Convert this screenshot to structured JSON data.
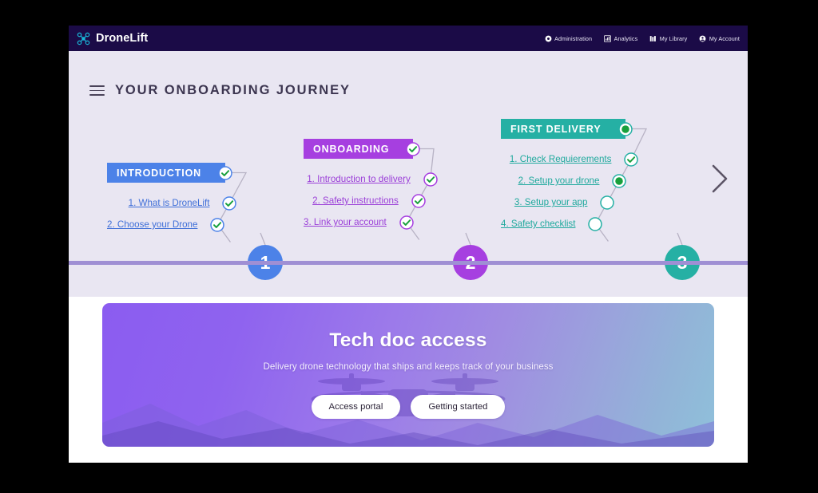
{
  "header": {
    "brand": "DroneLift",
    "logo_icon": "drone-icon",
    "nav": [
      {
        "label": "Administration",
        "icon": "gear-icon"
      },
      {
        "label": "Analytics",
        "icon": "bar-chart-icon"
      },
      {
        "label": "My Library",
        "icon": "books-icon"
      },
      {
        "label": "My Account",
        "icon": "user-circle-icon"
      }
    ]
  },
  "journey": {
    "menu_icon": "hamburger-menu-icon",
    "title": "YOUR ONBOARDING JOURNEY",
    "next_icon": "chevron-right-icon",
    "rail_color": "#9f8fd4",
    "steps": [
      {
        "number": "1",
        "label": "INTRODUCTION",
        "color": "#4c82e8",
        "link_color": "#3f6fd8",
        "badge_state": "complete",
        "items": [
          {
            "label": "1. What is DroneLift",
            "state": "complete"
          },
          {
            "label": "2. Choose your Drone",
            "state": "complete"
          }
        ]
      },
      {
        "number": "2",
        "label": "ONBOARDING",
        "color": "#a63fe0",
        "link_color": "#9b3fd8",
        "badge_state": "complete",
        "items": [
          {
            "label": "1. Introduction to delivery",
            "state": "complete"
          },
          {
            "label": "2. Safety instructions",
            "state": "complete"
          },
          {
            "label": "3. Link your account",
            "state": "complete"
          }
        ]
      },
      {
        "number": "3",
        "label": "FIRST DELIVERY",
        "color": "#25b0a4",
        "link_color": "#1fa99d",
        "badge_state": "current",
        "items": [
          {
            "label": "1. Check Requierements",
            "state": "complete"
          },
          {
            "label": "2. Setup your drone",
            "state": "current"
          },
          {
            "label": "3. Setup your app",
            "state": "pending"
          },
          {
            "label": "4. Safety checklist",
            "state": "pending"
          }
        ]
      }
    ]
  },
  "hero": {
    "title": "Tech doc access",
    "subtitle": "Delivery drone technology that ships and keeps track of your business",
    "buttons": [
      {
        "label": "Access portal"
      },
      {
        "label": "Getting started"
      }
    ]
  }
}
